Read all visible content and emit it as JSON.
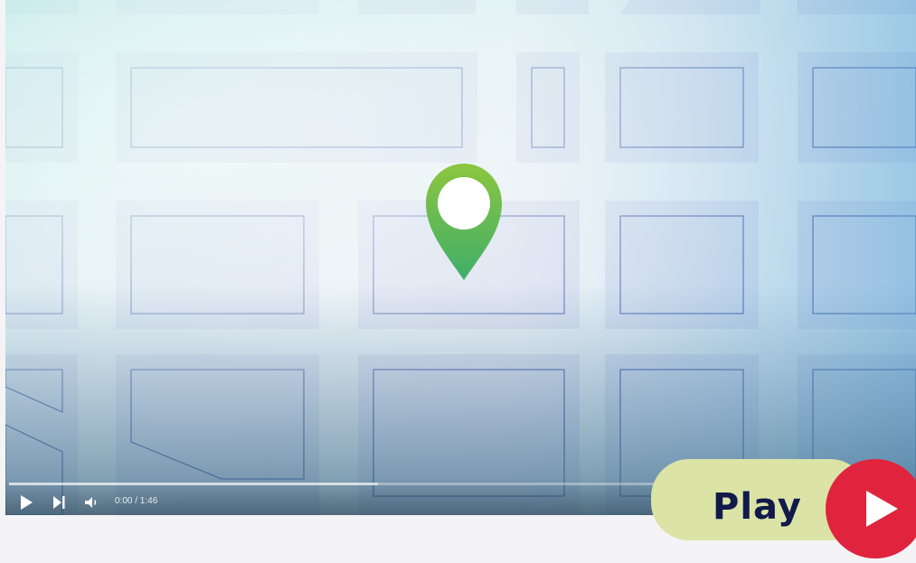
{
  "video": {
    "time_display": "0:00 / 1:46",
    "progress_fraction": 0,
    "buffered_fraction": 0.41
  },
  "cta": {
    "label": "Play"
  },
  "colors": {
    "accent_red": "#e0243e",
    "cta_bg": "#dbe4a6",
    "cta_text": "#111a4a",
    "pin_top": "#8cc63f",
    "pin_bottom": "#3fae6a"
  },
  "icons": [
    "play-icon",
    "skip-next-icon",
    "volume-icon",
    "map-pin-icon"
  ]
}
